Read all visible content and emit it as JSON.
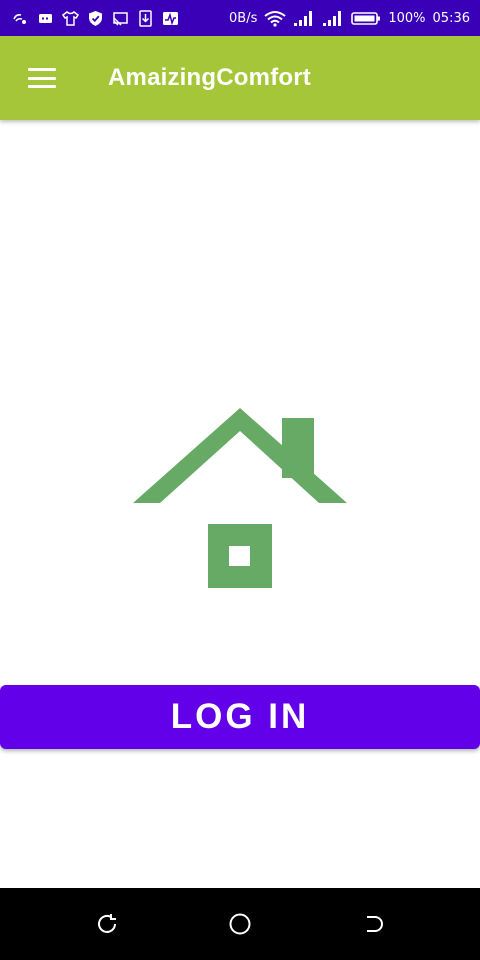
{
  "status_bar": {
    "net_speed": "0B/s",
    "battery": "100%",
    "time": "05:36",
    "left_icons": [
      "wifi-calling-icon",
      "chat-bubble-icon",
      "tshirt-icon",
      "shield-icon",
      "cast-icon",
      "download-icon",
      "activity-icon"
    ]
  },
  "app_bar": {
    "title": "AmaizingComfort",
    "background": "#a5c639"
  },
  "logo": {
    "icon": "house-icon",
    "color": "#66aa66"
  },
  "login": {
    "label": "LOG IN",
    "color": "#6200ea"
  },
  "nav_bar": {
    "buttons": [
      "recent-apps-icon",
      "home-circle-icon",
      "back-icon"
    ]
  }
}
